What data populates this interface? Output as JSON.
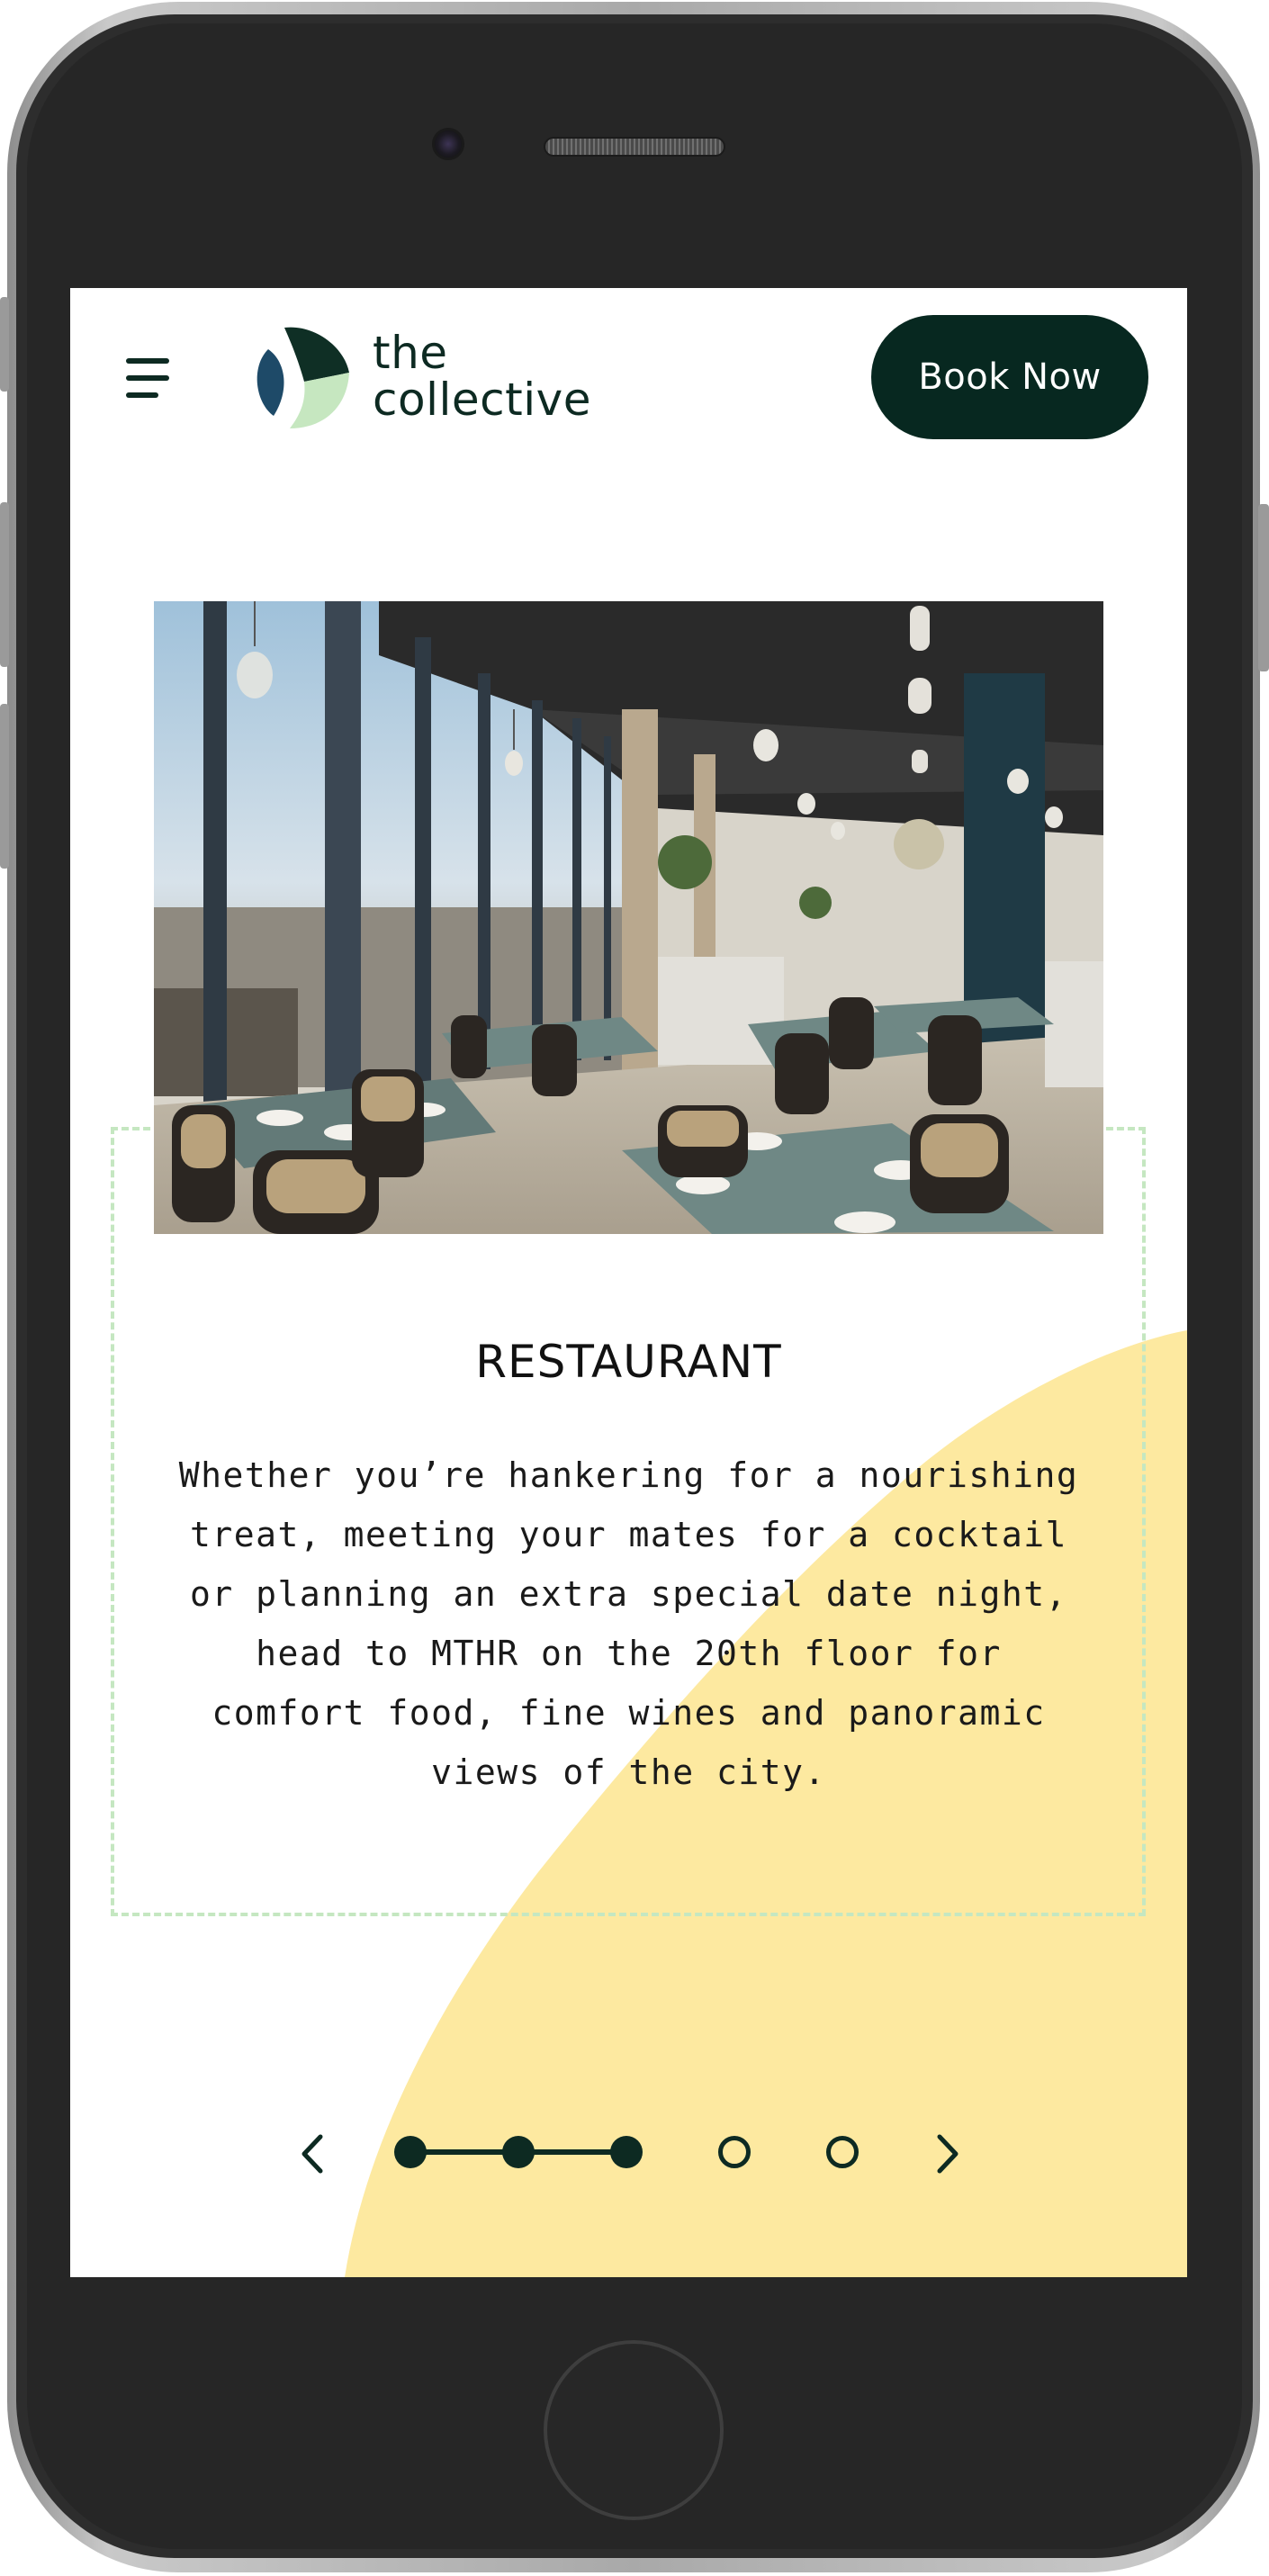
{
  "header": {
    "logo_line1": "the",
    "logo_line2": "collective",
    "book_label": "Book Now"
  },
  "card": {
    "title": "RESTAURANT",
    "description": "Whether you’re hankering for a nourishing treat, meeting your mates for a cocktail or planning an extra special date night, head to MTHR on the 20th floor for comfort food, fine wines and panoramic views of the city."
  },
  "carousel": {
    "total_slides": 5,
    "current_slide": 3
  },
  "colors": {
    "brand_dark": "#072820",
    "accent_yellow": "#fde9a0",
    "dashed_border": "#c5e7c1",
    "logo_blue": "#1e4a68",
    "logo_green": "#c6e7c0"
  },
  "icons": {
    "menu": "hamburger-menu-icon",
    "prev": "chevron-left-icon",
    "next": "chevron-right-icon"
  }
}
